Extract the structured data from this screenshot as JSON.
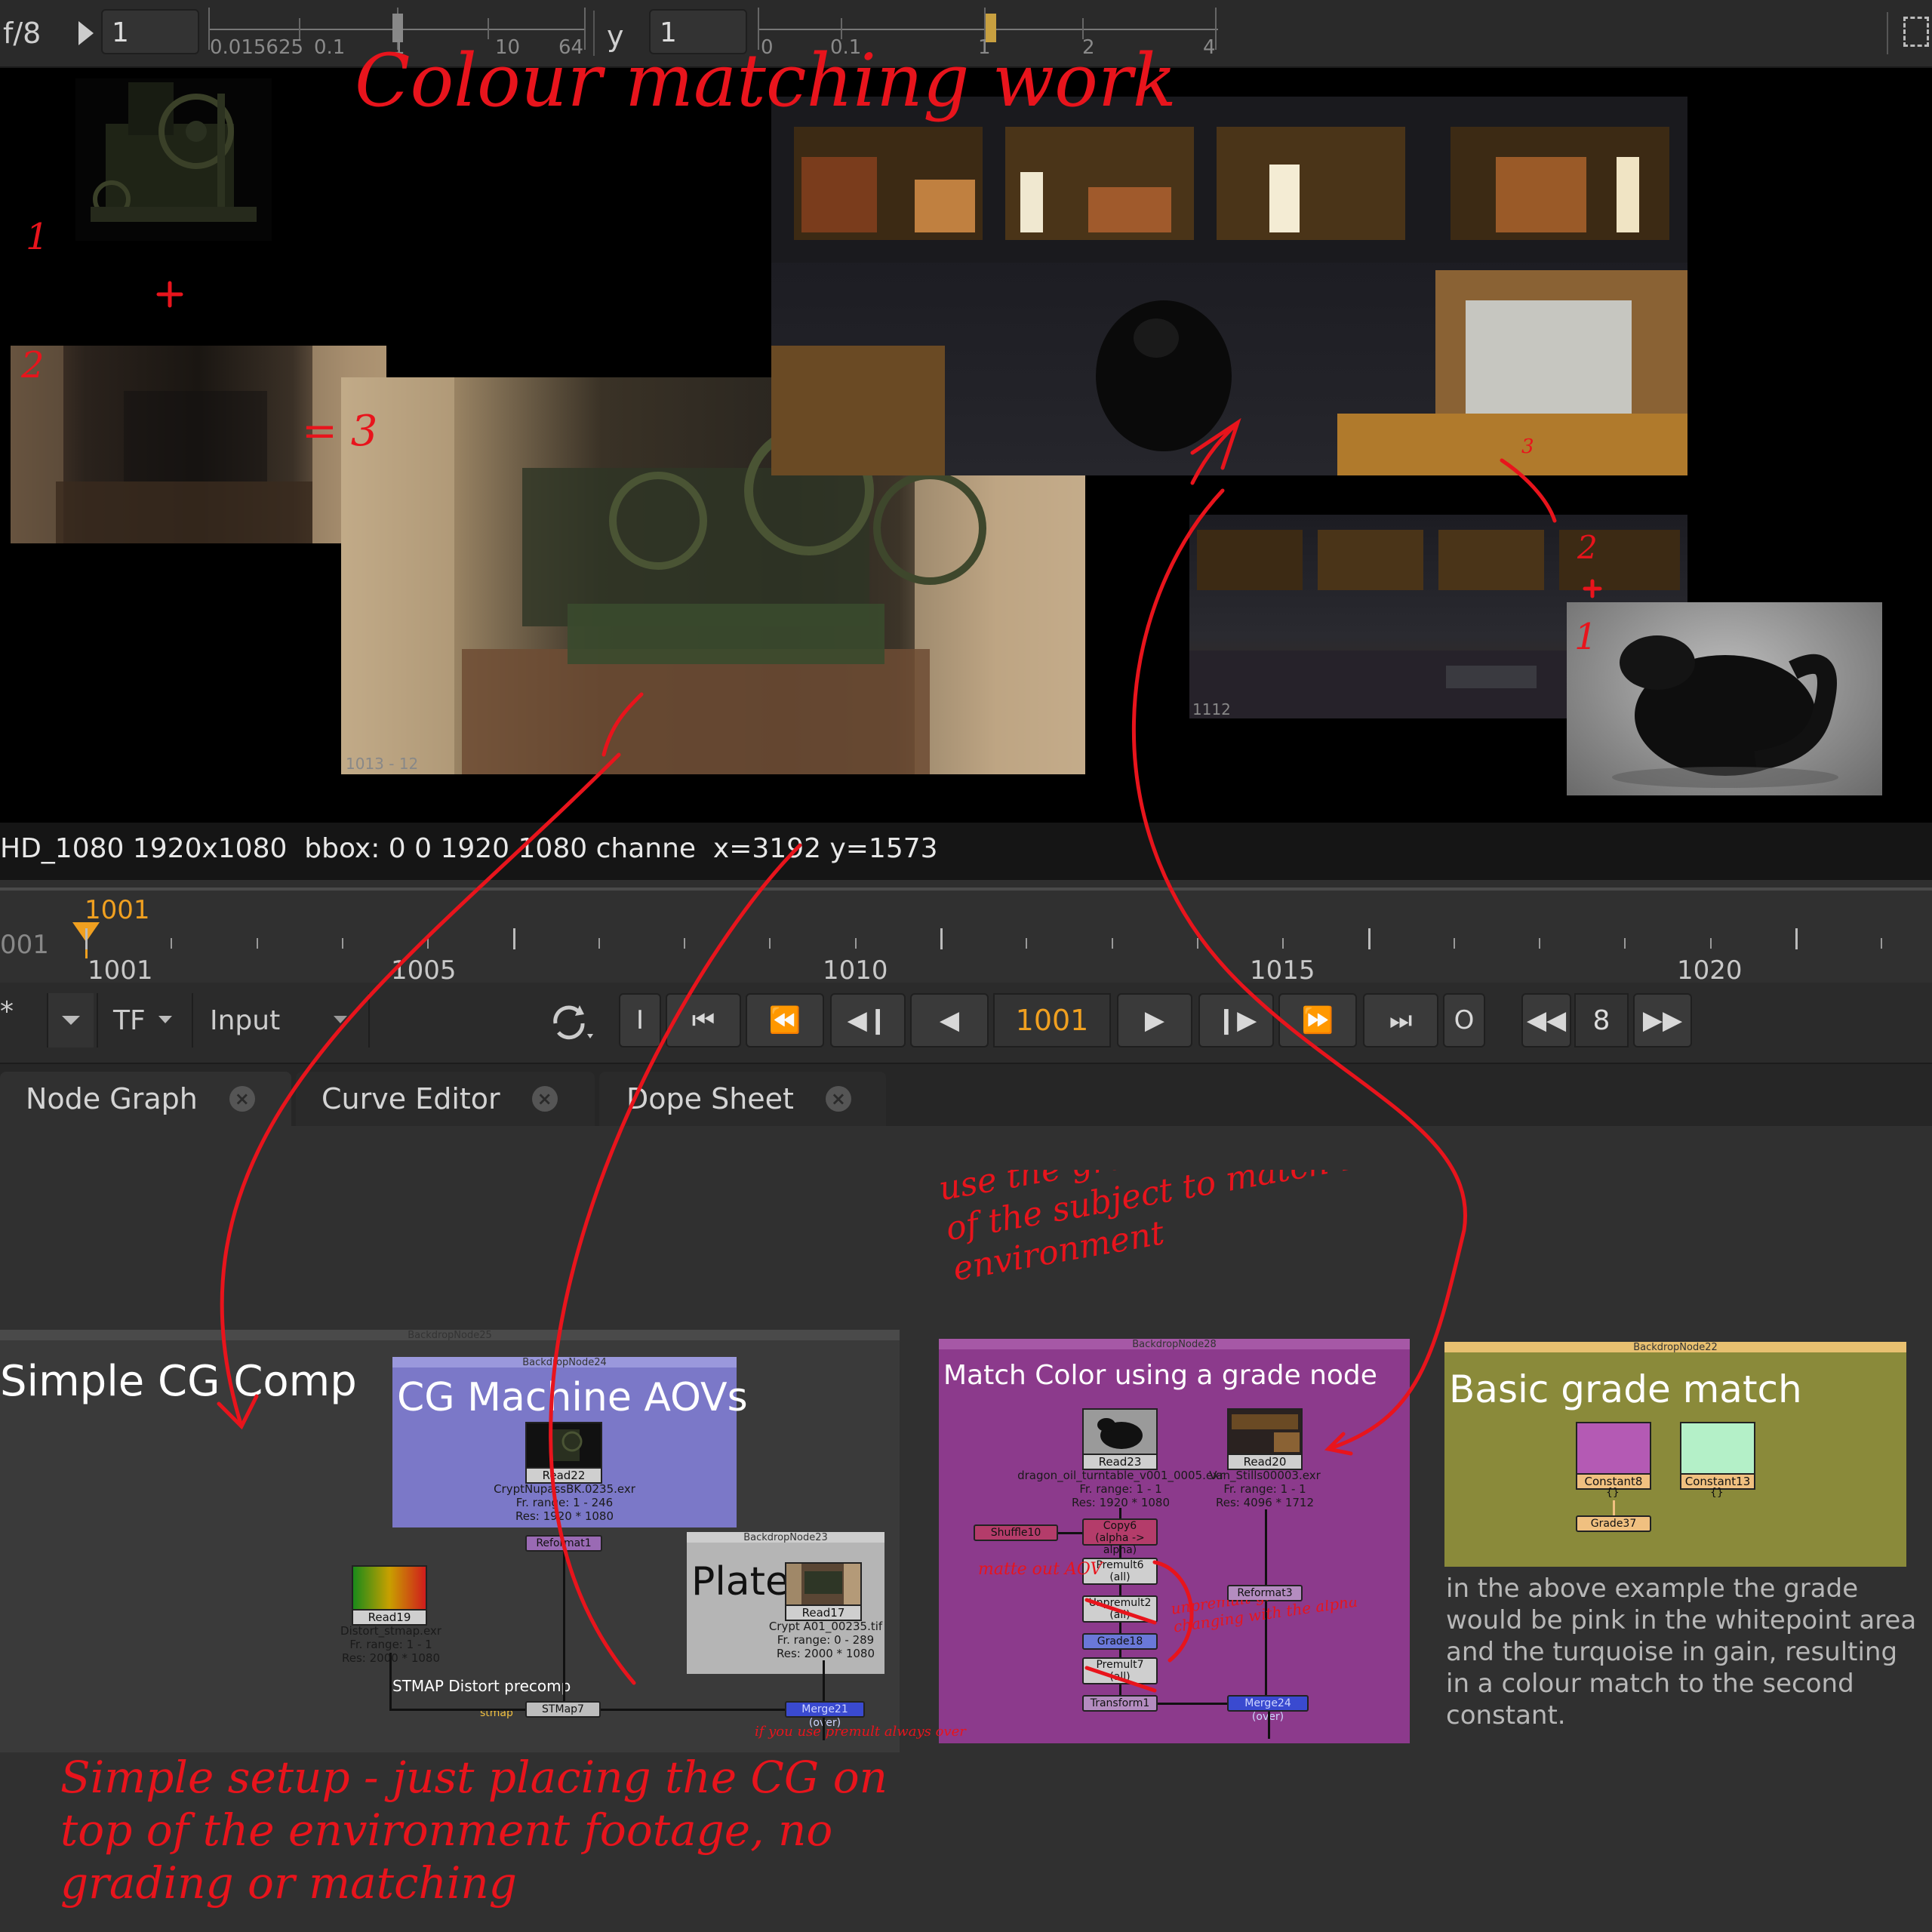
{
  "viewer_toolbar": {
    "fstop": "f/8",
    "gain_value": "1",
    "gain_ticks": [
      "0.015625",
      "0.1",
      "1",
      "10",
      "64"
    ],
    "gamma_label": "y",
    "gamma_value": "1",
    "gamma_ticks": [
      "0",
      "0.1",
      "1",
      "2",
      "4"
    ]
  },
  "viewer": {
    "info": "HD_1080 1920x1080  bbox: 0 0 1920 1080 channe  x=3192 y=1573",
    "plate_frame_label": "1013 - 12",
    "small_plate_label": "1112"
  },
  "timeline": {
    "current_frame": "1001",
    "left_cut": "001",
    "major_labels": [
      "1001",
      "1005",
      "1010",
      "1015",
      "1020"
    ]
  },
  "transport": {
    "star": "*",
    "tf_label": "TF",
    "input_label": "Input",
    "frame_field": "1001",
    "step_value": "8",
    "in_label": "I",
    "out_label": "O"
  },
  "tabs": [
    {
      "label": "Node Graph",
      "active": true
    },
    {
      "label": "Curve Editor",
      "active": false
    },
    {
      "label": "Dope Sheet",
      "active": false
    }
  ],
  "node_graph": {
    "bd25": {
      "id": "BackdropNode25",
      "title": "Simple CG Comp"
    },
    "bd24": {
      "id": "BackdropNode24",
      "title": "CG Machine AOVs"
    },
    "bd23": {
      "id": "BackdropNode23",
      "title": "Plate"
    },
    "bd28": {
      "id": "BackdropNode28",
      "title": "Match Color using a grade node"
    },
    "bd22": {
      "id": "BackdropNode22",
      "title": "Basic grade match"
    },
    "read22": {
      "name": "Read22",
      "file": "CryptNupassBK.0235.exr",
      "range": "Fr. range: 1 - 246",
      "res": "Res: 1920 * 1080"
    },
    "reformat1": "Reformat1",
    "read19": {
      "name": "Read19",
      "file": "Distort_stmap.exr",
      "range": "Fr. range: 1 - 1",
      "res": "Res: 2000 * 1080"
    },
    "read17": {
      "name": "Read17",
      "file": "Crypt A01_00235.tif",
      "range": "Fr. range: 0 - 289",
      "res": "Res: 2000 * 1080"
    },
    "stmap_label": "STMAP Distort precomp",
    "stmap_input": "stmap",
    "stmap7": "STMap7",
    "merge21": "Merge21 (over)",
    "read23": {
      "name": "Read23",
      "file": "dragon_oil_turntable_v001_0005.exr",
      "range": "Fr. range: 1 - 1",
      "res": "Res: 1920 * 1080"
    },
    "read20": {
      "name": "Read20",
      "file": "Van_Stills00003.exr",
      "range": "Fr. range: 1 - 1",
      "res": "Res: 4096 * 1712"
    },
    "shuffle10": "Shuffle10",
    "copy6": "Copy6",
    "copy6_sub": "(alpha -> alpha)",
    "premult6": "Premult6",
    "premult6_sub": "(all)",
    "unpremult2": "Unpremult2",
    "unpremult2_sub": "(all)",
    "grade18": "Grade18",
    "premult7": "Premult7",
    "premult7_sub": "(all)",
    "transform1": "Transform1",
    "reformat3": "Reformat3",
    "merge24": "Merge24 (over)",
    "constant8": "Constant8",
    "constant13": "Constant13",
    "grade37": "Grade37",
    "braces": "{}"
  },
  "caption": "in the above example the grade would be pink in the whitepoint area and the turquoise in gain, resulting in a colour match to the second constant.",
  "annotations": {
    "title": "Colour matching work",
    "n1": "1",
    "n2": "2",
    "n3": "= 3",
    "n2b": "2",
    "n1b": "1",
    "n3b": "3",
    "grade_note": "use the grade to adjust the colour of the subject to match it with the environment",
    "matte_note": "matte out AOV",
    "unpremult_note": "unpremult grade before changing with the alpha",
    "premult_note": "if you use premult always over",
    "bottom_note": "Simple setup - just placing the CG on top of the environment footage, no grading or matching"
  },
  "colors": {
    "annotation_red": "#e8141c",
    "bd_simple": "#3a3a3a",
    "bd_cg": "#7b78c8",
    "bd_plate": "#b5b5b5",
    "bd_match": "#8c3a8c",
    "bd_basic": "#8a8a3a",
    "constant_pink": "#b45ab4",
    "constant_mint": "#b4f0c8",
    "timeline_orange": "#f0a020"
  }
}
